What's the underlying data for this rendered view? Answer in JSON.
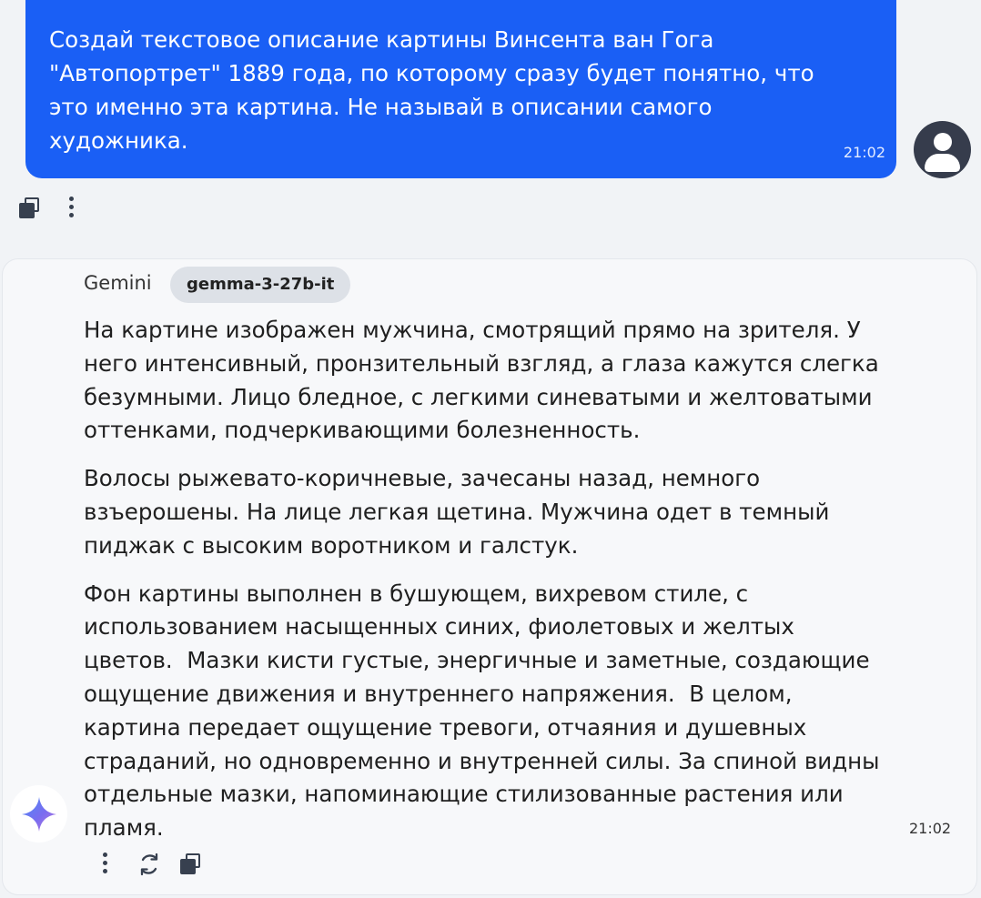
{
  "user_message": {
    "text": "Создай текстовое описание картины Винсента ван Гога\n\"Автопортрет\" 1889 года, по которому сразу будет понятно, что\nэто именно эта картина. Не называй в описании самого\nхудожника.",
    "time": "21:02"
  },
  "user_actions": {
    "copy_icon": "copy-icon",
    "more_icon": "more-vertical-icon"
  },
  "assistant": {
    "name": "Gemini",
    "model": "gemma-3-27b-it",
    "paragraphs": [
      "На картине изображен мужчина, смотрящий прямо на зрителя. У\nнего интенсивный, пронзительный взгляд, а глаза кажутся слегка\nбезумными. Лицо бледное, с легкими синеватыми и желтоватыми\nоттенками, подчеркивающими болезненность.",
      "Волосы рыжевато-коричневые, зачесаны назад, немного\nвзъерошены. На лице легкая щетина. Мужчина одет в темный\nпиджак с высоким воротником и галстук.",
      "Фон картины выполнен в бушующем, вихревом стиле, с\nиспользованием насыщенных синих, фиолетовых и желтых\nцветов.  Мазки кисти густые, энергичные и заметные, создающие\nощущение движения и внутреннего напряжения.  В целом,\nкартина передает ощущение тревоги, отчаяния и душевных\nстраданий, но одновременно и внутренней силы. За спиной видны\nотдельные мазки, напоминающие стилизованные растения или\nпламя."
    ],
    "time": "21:02"
  },
  "assistant_actions": {
    "more_icon": "more-vertical-icon",
    "regenerate_icon": "refresh-icon",
    "copy_icon": "copy-icon"
  },
  "colors": {
    "user_bubble": "#1a5ff5",
    "background": "#f1f3f6",
    "card": "#f7f8fa"
  }
}
